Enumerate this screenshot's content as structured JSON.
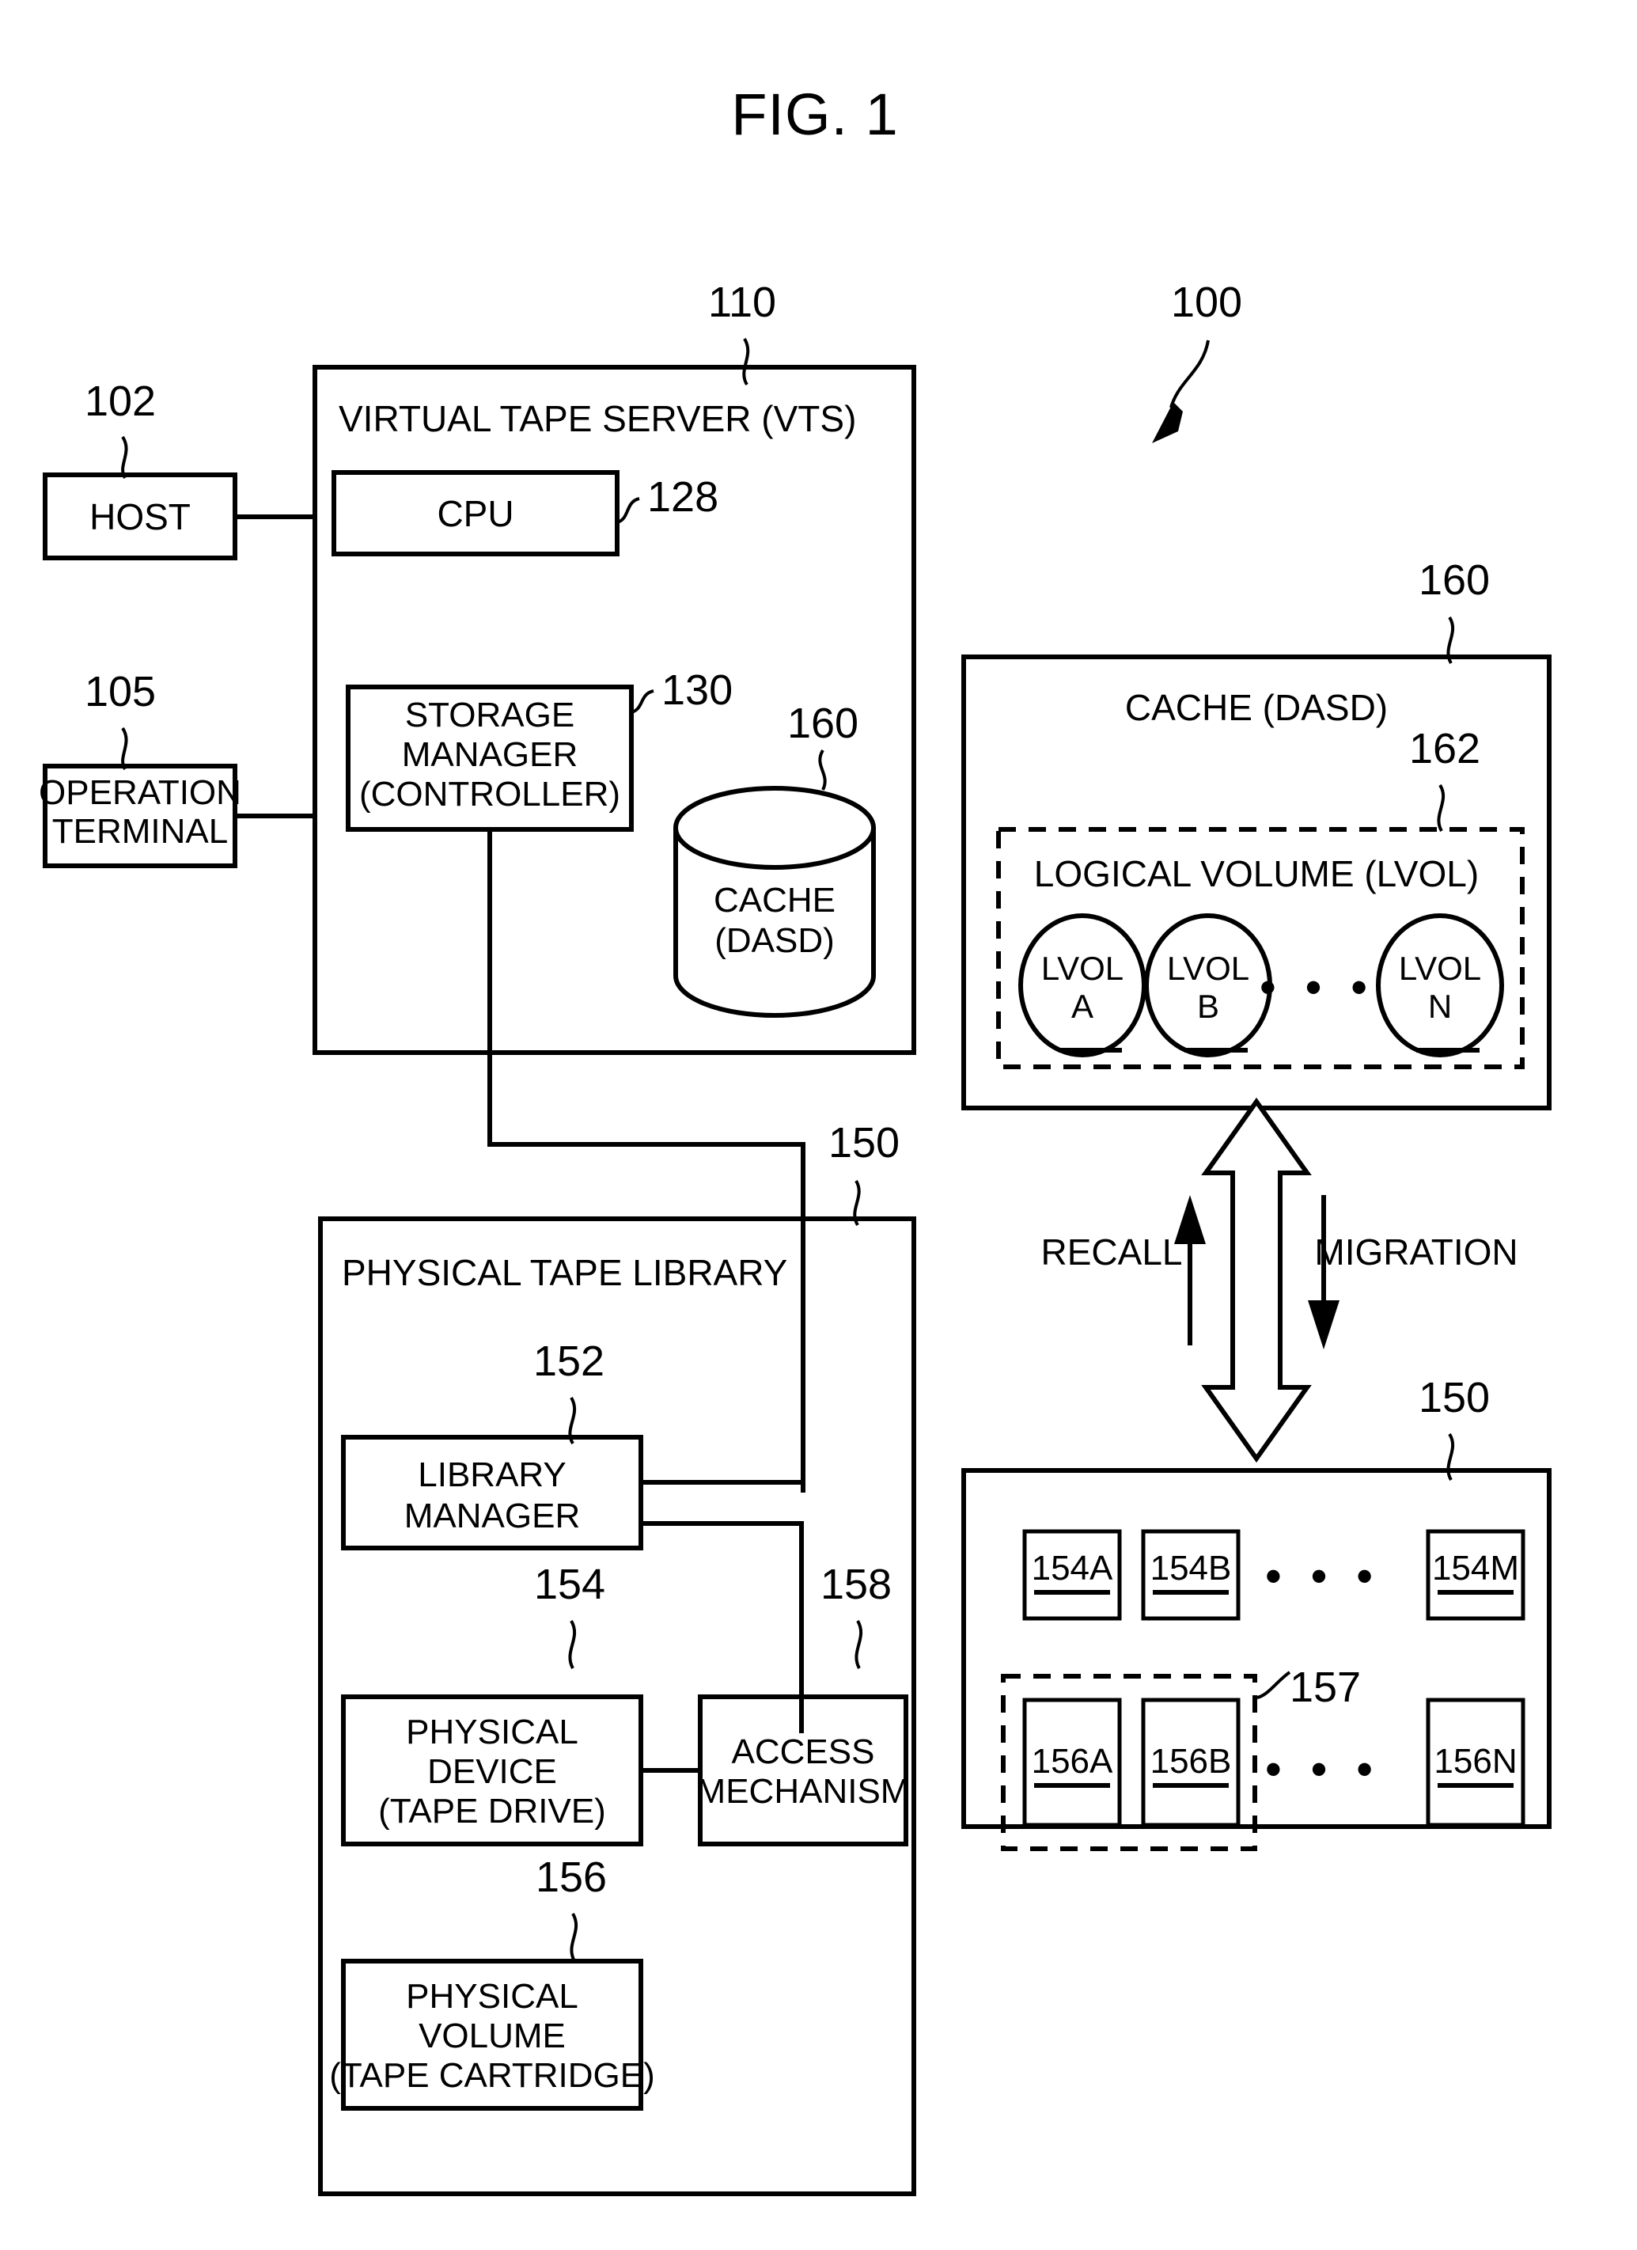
{
  "figure": {
    "title": "FIG. 1",
    "system_ref": "100"
  },
  "left_column": {
    "host": {
      "label": "HOST",
      "ref": "102"
    },
    "operation_terminal": {
      "line1": "OPERATION",
      "line2": "TERMINAL",
      "ref": "105"
    }
  },
  "vts": {
    "title": "VIRTUAL TAPE SERVER (VTS)",
    "ref": "110",
    "cpu": {
      "label": "CPU",
      "ref": "128"
    },
    "storage_manager": {
      "line1": "STORAGE",
      "line2": "MANAGER",
      "line3": "(CONTROLLER)",
      "ref": "130"
    },
    "cache_cylinder": {
      "line1": "CACHE",
      "line2": "(DASD)",
      "ref": "160"
    }
  },
  "physical_tape_library": {
    "title": "PHYSICAL TAPE LIBRARY",
    "ref": "150",
    "library_manager": {
      "line1": "LIBRARY",
      "line2": "MANAGER",
      "ref": "152"
    },
    "physical_device": {
      "line1": "PHYSICAL",
      "line2": "DEVICE",
      "line3": "(TAPE DRIVE)",
      "ref": "154"
    },
    "access_mechanism": {
      "line1": "ACCESS",
      "line2": "MECHANISM",
      "ref": "158"
    },
    "physical_volume": {
      "line1": "PHYSICAL",
      "line2": "VOLUME",
      "line3": "(TAPE CARTRIDGE)",
      "ref": "156"
    }
  },
  "cache_detail": {
    "title": "CACHE (DASD)",
    "ref": "160",
    "logical_volume_group": {
      "title": "LOGICAL VOLUME (LVOL)",
      "ref": "162",
      "ellipsis": "• • •",
      "volumes": [
        {
          "line1": "LVOL",
          "line2": "A"
        },
        {
          "line1": "LVOL",
          "line2": "B"
        },
        {
          "line1": "LVOL",
          "line2": "N"
        }
      ]
    }
  },
  "flow": {
    "recall_label": "RECALL",
    "migration_label": "MIGRATION"
  },
  "library_detail": {
    "ref": "150",
    "drive_row": {
      "ellipsis": "• • •",
      "slots": [
        "154A",
        "154B",
        "154M"
      ]
    },
    "volume_row": {
      "ellipsis": "• • •",
      "group_ref": "157",
      "slots": [
        "156A",
        "156B",
        "156N"
      ]
    }
  }
}
